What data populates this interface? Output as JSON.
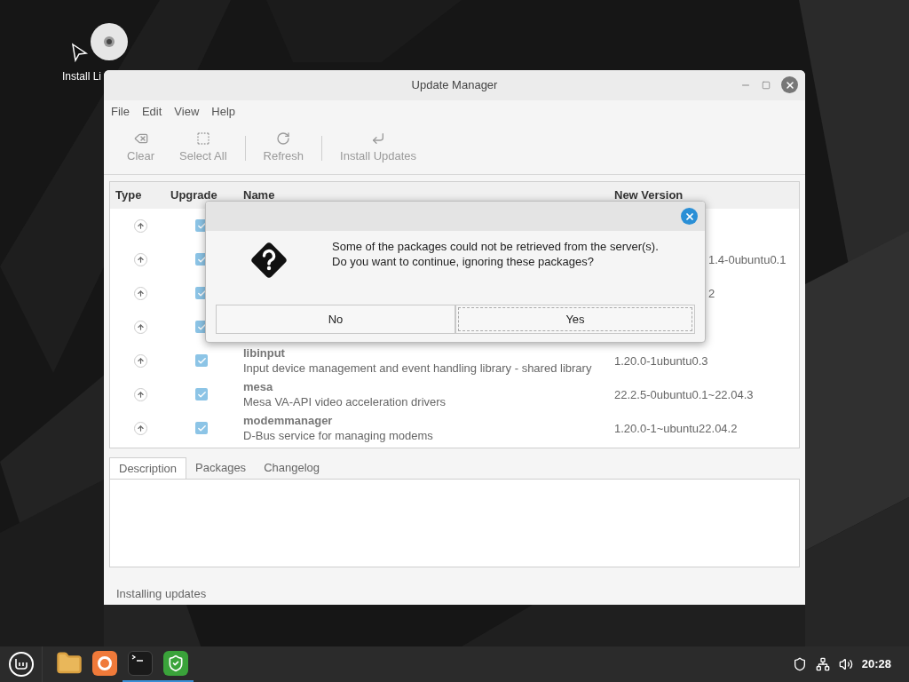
{
  "desktop": {
    "icons": [
      {
        "label": "Install Li"
      }
    ]
  },
  "window": {
    "title": "Update Manager",
    "menu": [
      "File",
      "Edit",
      "View",
      "Help"
    ],
    "toolbar": [
      {
        "label": "Clear",
        "kind": "clear",
        "disabled": true
      },
      {
        "label": "Select All",
        "kind": "select",
        "disabled": true
      },
      {
        "label": "Refresh",
        "kind": "refresh",
        "disabled": true
      },
      {
        "label": "Install Updates",
        "kind": "install",
        "disabled": true
      }
    ],
    "table": {
      "columns": [
        "Type",
        "Upgrade",
        "Name",
        "New Version"
      ],
      "rows": [
        {
          "kind": "covered",
          "checked": true
        },
        {
          "kind": "covered",
          "checked": true,
          "version": "1.4-0ubuntu0.1"
        },
        {
          "kind": "covered",
          "checked": true,
          "version": "2"
        },
        {
          "kind": "covered",
          "checked": true
        },
        {
          "kind": "full",
          "checked": true,
          "name": "libinput",
          "description": "Input device management and event handling library - shared library",
          "version": "1.20.0-1ubuntu0.3"
        },
        {
          "kind": "full",
          "checked": true,
          "name": "mesa",
          "description": "Mesa VA-API video acceleration drivers",
          "version": "22.2.5-0ubuntu0.1~22.04.3"
        },
        {
          "kind": "full",
          "checked": true,
          "name": "modemmanager",
          "description": "D-Bus service for managing modems",
          "version": "1.20.0-1~ubuntu22.04.2"
        }
      ]
    },
    "tabs": [
      {
        "label": "Description",
        "selected": true
      },
      {
        "label": "Packages",
        "selected": false
      },
      {
        "label": "Changelog",
        "selected": false
      }
    ],
    "status_bar": "Installing updates"
  },
  "dialog": {
    "message": [
      "Some of the packages could not be retrieved from the server(s).",
      "Do you want to continue, ignoring these packages?"
    ],
    "buttons": [
      {
        "label": "No",
        "focused": false
      },
      {
        "label": "Yes",
        "focused": true
      }
    ]
  },
  "taskbar": {
    "apps": [
      {
        "kind": "files",
        "active": false
      },
      {
        "kind": "browser",
        "active": false
      },
      {
        "kind": "terminal",
        "active": true
      },
      {
        "kind": "shield",
        "active": true
      }
    ],
    "clock": "20:28"
  }
}
